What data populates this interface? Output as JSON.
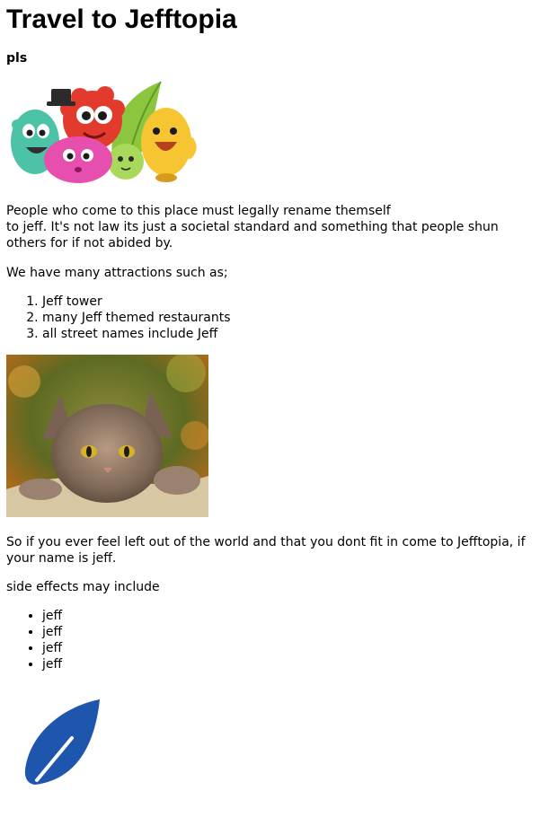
{
  "page": {
    "title": "Travel to Jefftopia",
    "subtitle": "pls",
    "intro_line1": "People who come to this place must legally rename themself",
    "intro_line2": "to jeff. It's not law its just a societal standard and something that people shun others for if not abided by.",
    "attractions_intro": "We have many attractions such as;",
    "attractions": [
      "Jeff tower",
      "many Jeff themed restaurants",
      "all street names include Jeff"
    ],
    "closing": "So if you ever feel left out of the world and that you dont fit in come to Jefftopia, if your name is jeff.",
    "side_effects_intro": "side effects may include",
    "side_effects": [
      "jeff",
      "jeff",
      "jeff",
      "jeff"
    ]
  },
  "images": {
    "monsters": "cartoon-monsters-image",
    "cat": "cat-photo",
    "leaf": "blue-leaf-logo"
  },
  "colors": {
    "leaf": "#1f56ad",
    "text": "#000000",
    "background": "#ffffff"
  }
}
